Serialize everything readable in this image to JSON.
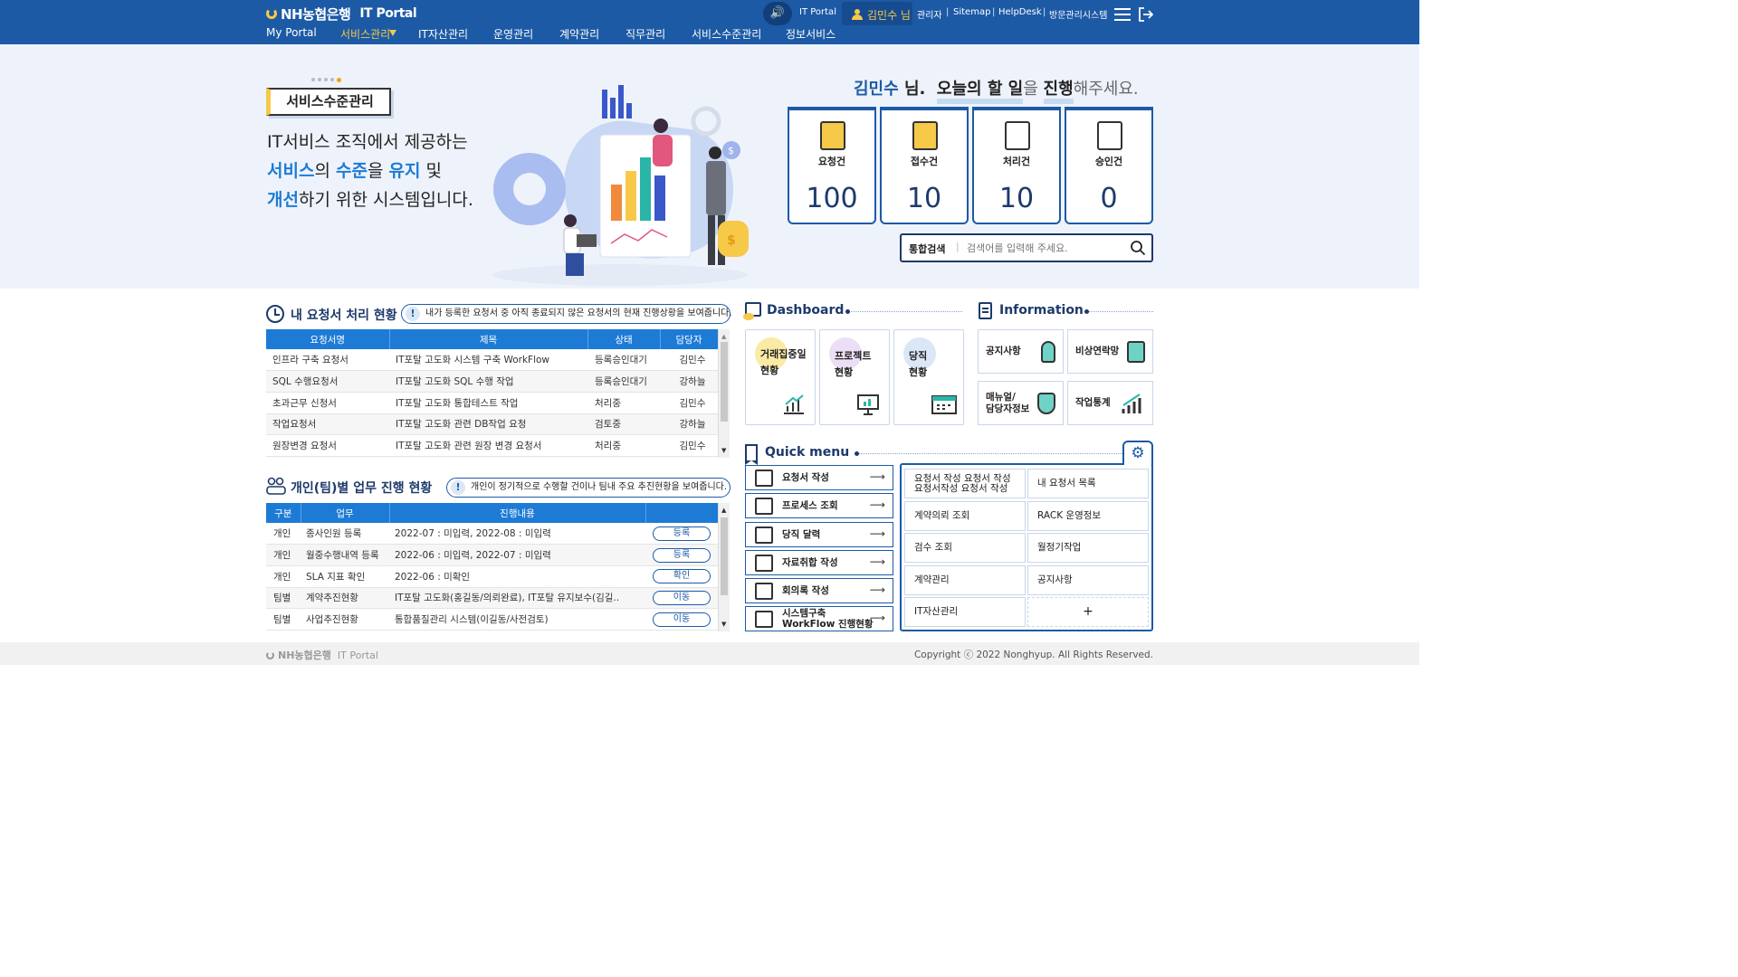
{
  "header": {
    "brand": "NH농협은행",
    "portal_title": "IT Portal",
    "speaker_label": "IT Portal",
    "user_name": "김민수 님",
    "util_links": [
      "관리자",
      "Sitemap",
      "HelpDesk",
      "방문관리시스템"
    ],
    "nav": [
      "My Portal",
      "서비스관리",
      "IT자산관리",
      "운영관리",
      "계약관리",
      "직무관리",
      "서비스수준관리",
      "정보서비스"
    ],
    "nav_active": "서비스관리"
  },
  "hero": {
    "badge": "서비스수준관리",
    "line1": "IT서비스 조직에서 제공하는",
    "line2_parts": [
      "서비스",
      "의 ",
      "수준",
      "을 ",
      "유지",
      " 및"
    ],
    "line3_parts": [
      "개선",
      "하기 위한 시스템입니다."
    ],
    "greeting_name": "김민수",
    "greeting_rest1": " 님.  ",
    "greeting_todo": "오늘의 할 일",
    "greeting_eul": "을 ",
    "greeting_proceed": "진행",
    "greeting_end": "해주세요.",
    "stats": [
      {
        "label": "요청건",
        "value": "100"
      },
      {
        "label": "접수건",
        "value": "10"
      },
      {
        "label": "처리건",
        "value": "10"
      },
      {
        "label": "승인건",
        "value": "0"
      }
    ],
    "search_label": "통합검색",
    "search_placeholder": "검색어를 입력해 주세요."
  },
  "requests": {
    "title": "내 요청서 처리 현황",
    "tip": "내가 등록한 요청서 중 아직 종료되지 않은 요청서의 현재 진행상황을 보여줍니다.",
    "columns": [
      "요청서명",
      "제목",
      "상태",
      "담당자"
    ],
    "rows": [
      [
        "인프라 구축 요청서",
        "IT포탈 고도화 시스템 구축 WorkFlow",
        "등록승인대기",
        "김민수"
      ],
      [
        "SQL 수행요청서",
        "IT포탈 고도화 SQL 수행 작업",
        "등록승인대기",
        "강하늘"
      ],
      [
        "초과근무 신청서",
        "IT포탈 고도화 통합테스트 작업",
        "처리중",
        "김민수"
      ],
      [
        "작업요청서",
        "IT포탈 고도화 관련 DB작업 요청",
        "검토중",
        "강하늘"
      ],
      [
        "원장변경 요청서",
        "IT포탈 고도화 관련 원장 변경 요청서",
        "처리중",
        "김민수"
      ]
    ]
  },
  "tasks": {
    "title": "개인(팀)별 업무 진행 현황",
    "tip": "개인이 정기적으로 수행할 건이나 팀내 주요 추진현황을 보여줍니다.",
    "columns": [
      "구분",
      "업무",
      "진행내용",
      ""
    ],
    "rows": [
      [
        "개인",
        "종사인원 등록",
        "2022-07 : 미입력, 2022-08 : 미입력",
        "등록"
      ],
      [
        "개인",
        "월중수행내역 등록",
        "2022-06 : 미입력, 2022-07 : 미입력",
        "등록"
      ],
      [
        "개인",
        "SLA 지표 확인",
        "2022-06 : 미확인",
        "확인"
      ],
      [
        "팀별",
        "계약추진현황",
        "IT포탈 고도화(홍길동/의뢰완료), IT포탈 유지보수(김길..",
        "이동"
      ],
      [
        "팀별",
        "사업추진현황",
        "통합품질관리 시스템(이길동/사전검토)",
        "이동"
      ]
    ]
  },
  "dashboard": {
    "title": "Dashboard",
    "tiles": [
      {
        "l1": "거래집중일",
        "l2": "현황",
        "color": "#fbeaa5"
      },
      {
        "l1": "프로젝트",
        "l2": "현황",
        "color": "#ecdff5"
      },
      {
        "l1": "당직",
        "l2": "현황",
        "color": "#dbe7f6"
      }
    ]
  },
  "information": {
    "title": "Information",
    "tiles": [
      "공지사항",
      "비상연락망",
      "매뉴얼/\n담당자정보",
      "작업통계"
    ]
  },
  "quick": {
    "title": "Quick menu",
    "buttons": [
      "요청서 작성",
      "프로세스 조회",
      "당직 달력",
      "자료취합 작성",
      "회의록 작성",
      "시스템구축\nWorkFlow 진행현황"
    ],
    "grid": [
      "요청서 작성 요청서 작성\n요청서작성 요청서 작성",
      "내 요청서 목록",
      "계약의뢰 조회",
      "RACK 운영정보",
      "검수 조회",
      "월정기작업",
      "계약관리",
      "공지사항",
      "IT자산관리",
      "+"
    ]
  },
  "footer": {
    "brand": "NH농협은행",
    "portal": "IT Portal",
    "copyright": "Copyright ⓒ 2022 Nonghyup. All Rights Reserved."
  },
  "colors": {
    "primary": "#1d5aa6",
    "accent": "#f7c948",
    "table_head": "#1d7bd6"
  }
}
